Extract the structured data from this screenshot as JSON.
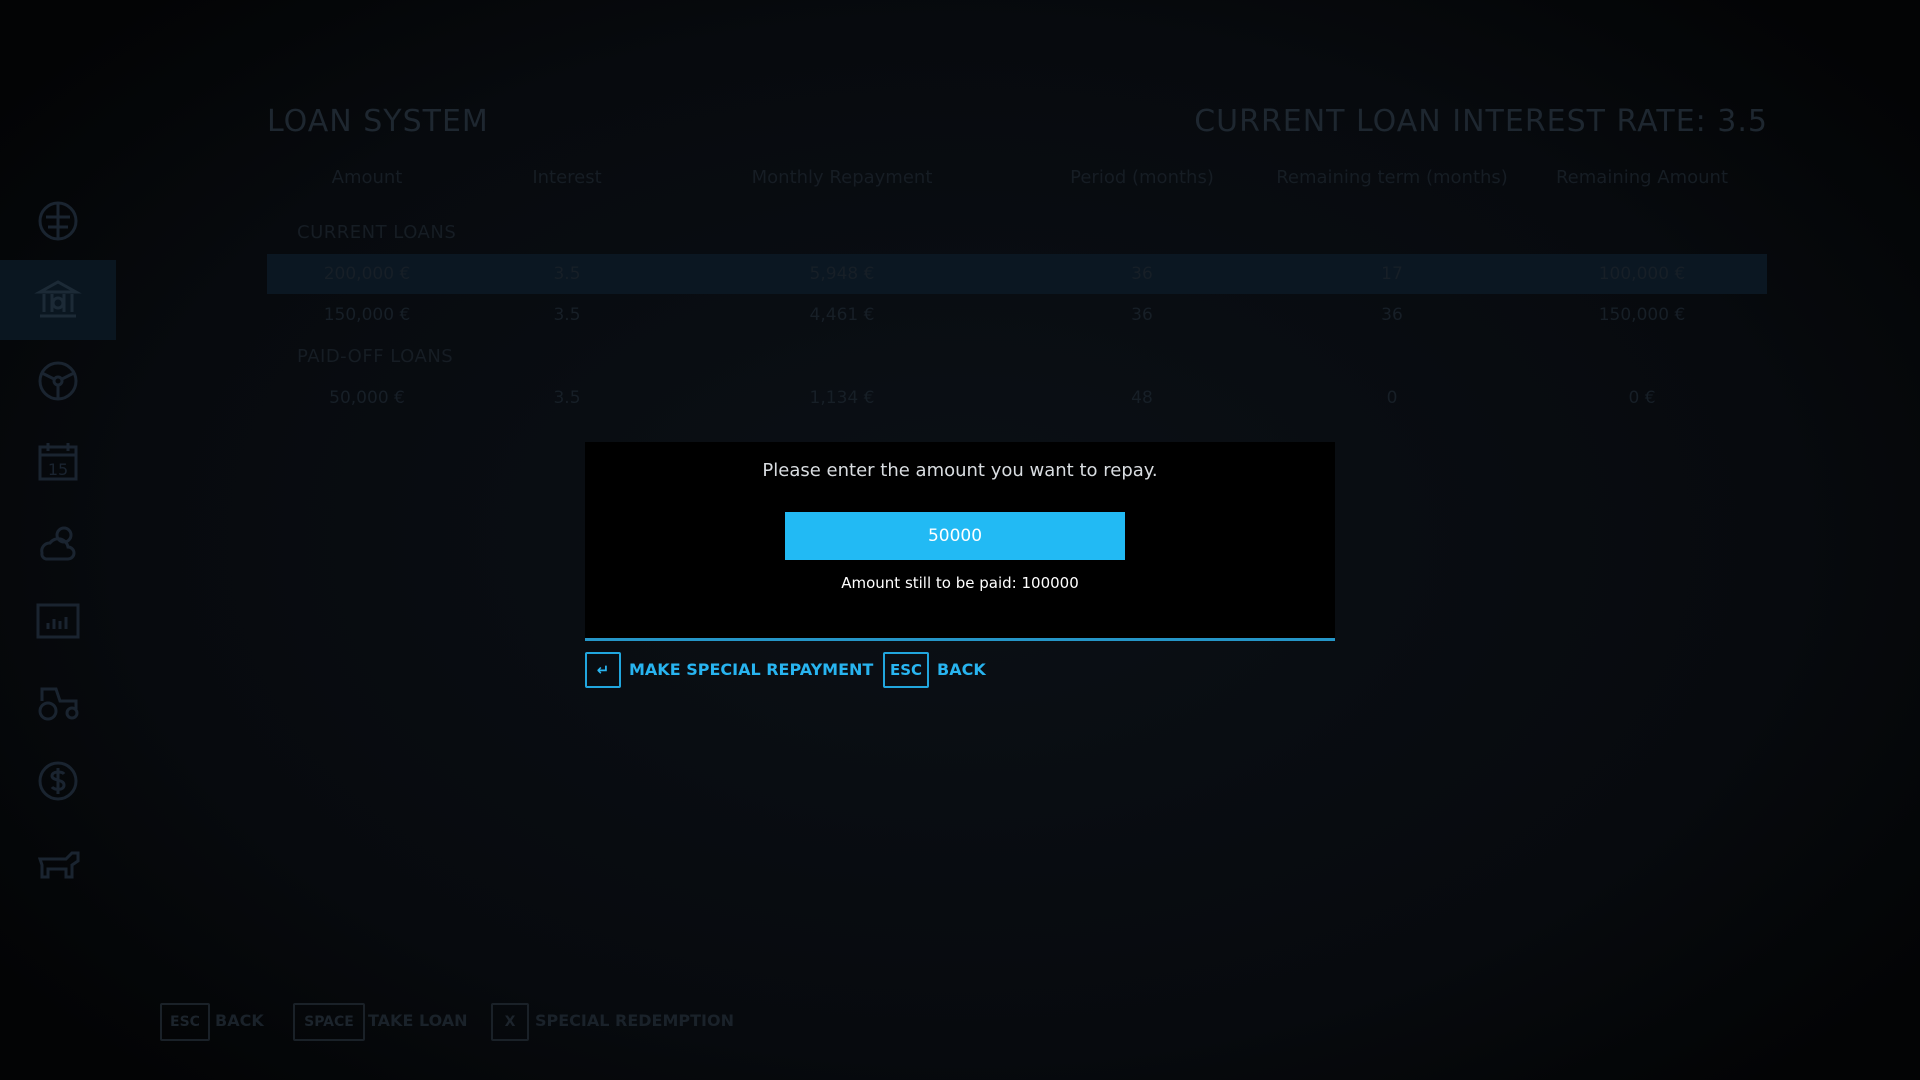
{
  "header": {
    "title": "LOAN SYSTEM",
    "interest_rate": "CURRENT LOAN INTEREST RATE: 3.5"
  },
  "table": {
    "columns": [
      "Amount",
      "Interest",
      "Monthly Repayment",
      "Period (months)",
      "Remaining term (months)",
      "Remaining Amount"
    ],
    "current_section": "CURRENT LOANS",
    "current_loans": [
      [
        "200,000 €",
        "3.5",
        "5,948 €",
        "36",
        "17",
        "100,000 €"
      ],
      [
        "150,000 €",
        "3.5",
        "4,461 €",
        "36",
        "36",
        "150,000 €"
      ]
    ],
    "paid_section": "PAID-OFF LOANS",
    "paid_loans": [
      [
        "50,000 €",
        "3.5",
        "1,134 €",
        "48",
        "0",
        "0 €"
      ]
    ]
  },
  "sidebar": {
    "items": [
      {
        "icon": "map-icon"
      },
      {
        "icon": "bank-icon",
        "active": true
      },
      {
        "icon": "steering-wheel-icon"
      },
      {
        "icon": "calendar-icon",
        "label": "15"
      },
      {
        "icon": "weather-icon"
      },
      {
        "icon": "statistics-icon"
      },
      {
        "icon": "tractor-icon"
      },
      {
        "icon": "dollar-icon"
      },
      {
        "icon": "animals-icon"
      }
    ]
  },
  "bottom_bar": {
    "back_key": "ESC",
    "back_label": "BACK",
    "loan_key": "SPACE",
    "loan_label": "TAKE LOAN",
    "redeem_key": "X",
    "redeem_label": "SPECIAL REDEMPTION"
  },
  "modal": {
    "prompt": "Please enter the amount you want to repay.",
    "input_value": "50000",
    "remaining_text": "Amount still to be paid: 100000",
    "confirm_key": "↵",
    "confirm_label": "MAKE SPECIAL REPAYMENT",
    "back_key": "ESC",
    "back_label": "BACK"
  },
  "colors": {
    "accent": "#22baf4",
    "accent_text": "#28b4f0",
    "modal_bg": "#000000"
  }
}
